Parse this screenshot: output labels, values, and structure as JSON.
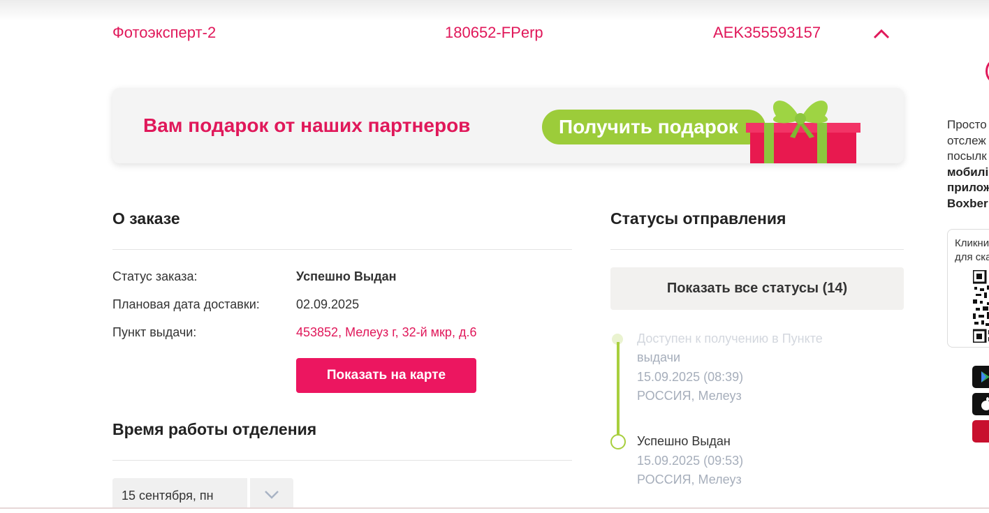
{
  "order": {
    "shop": "Фотоэксперт-2",
    "order_number": "180652-FPerp",
    "tracking_number": "AEK355593157"
  },
  "banner": {
    "title": "Вам подарок от наших партнеров",
    "button_label": "Получить подарок"
  },
  "about": {
    "title": "О заказе",
    "rows": [
      {
        "label": "Статус заказа:",
        "value": "Успешно Выдан"
      },
      {
        "label": "Плановая дата доставки:",
        "value": "02.09.2025"
      },
      {
        "label": "Пункт выдачи:",
        "value": "453852, Мелеуз г, 32-й мкр, д.6"
      }
    ],
    "map_button": "Показать на карте"
  },
  "work_hours": {
    "title": "Время работы отделения",
    "selected_date": "15 сентября, пн"
  },
  "statuses": {
    "title": "Статусы отправления",
    "show_all_button": "Показать все статусы (14)",
    "items": [
      {
        "line1": "Доступен к получению в Пункте",
        "line2": "выдачи",
        "datetime": "15.09.2025 (08:39)",
        "location": "РОССИЯ, Мелеуз"
      },
      {
        "line1": "Успешно Выдан",
        "datetime": "15.09.2025 (09:53)",
        "location": "РОССИЯ, Мелеуз"
      }
    ]
  },
  "sidebar": {
    "promo_lines": [
      "Просто",
      "отслеж",
      "посылк"
    ],
    "promo_bold_lines": [
      "мобилі",
      "прилож",
      "Boxber"
    ],
    "qr_caption_lines": [
      "Кликни",
      "для ска"
    ]
  },
  "colors": {
    "brand": "#e0185a",
    "accent_green": "#9ccc3a"
  }
}
